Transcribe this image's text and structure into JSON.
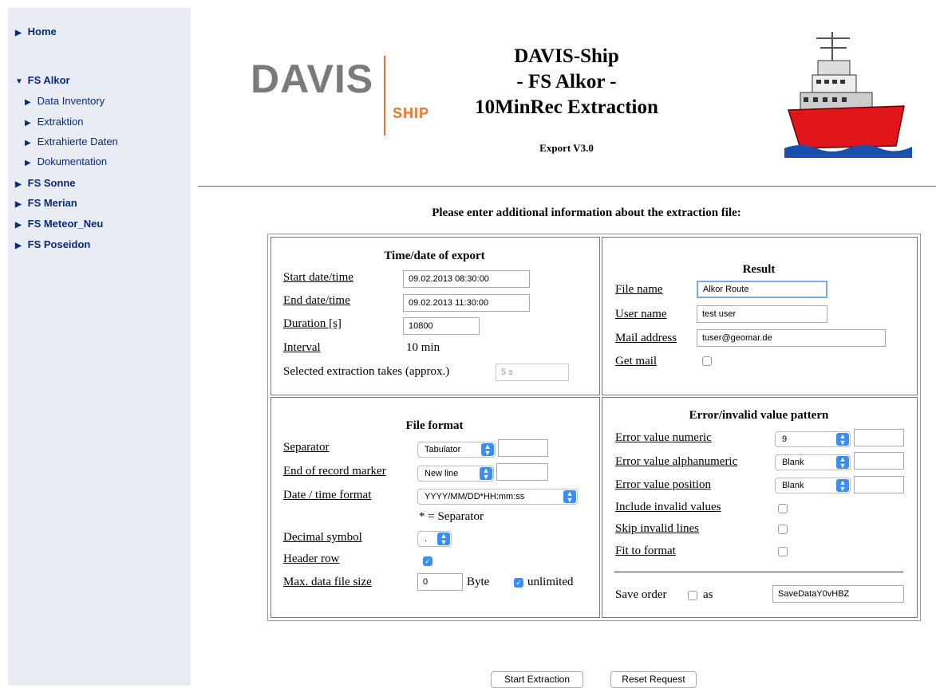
{
  "nav": {
    "home": "Home",
    "alkor": "FS Alkor",
    "alkor_items": [
      "Data Inventory",
      "Extraktion",
      "Extrahierte Daten",
      "Dokumentation"
    ],
    "sonne": "FS Sonne",
    "merian": "FS Merian",
    "meteor": "FS Meteor_Neu",
    "poseidon": "FS Poseidon"
  },
  "header": {
    "logo_main": "DAVIS",
    "logo_sub": "SHIP",
    "title_lines": [
      "DAVIS-Ship",
      "- FS Alkor -",
      "10MinRec Extraction"
    ],
    "version": "Export V3.0"
  },
  "prompt": "Please enter additional information about the extraction file:",
  "time": {
    "title": "Time/date of export",
    "start_label": "Start date/time",
    "start_value": "09.02.2013 08:30:00",
    "end_label": "End date/time",
    "end_value": "09.02.2013 11:30:00",
    "duration_label": "Duration [s]",
    "duration_value": "10800",
    "interval_label": "Interval",
    "interval_value": "10 min",
    "takes_label": "Selected extraction takes (approx.)",
    "takes_value": "5 s"
  },
  "result": {
    "title": "Result",
    "file_label": "File name",
    "file_value": "Alkor Route",
    "user_label": "User name",
    "user_value": "test user",
    "mail_label": "Mail address",
    "mail_value": "tuser@geomar.de",
    "getmail_label": "Get mail"
  },
  "format": {
    "title": "File format",
    "sep_label": "Separator",
    "sep_value": "Tabulator",
    "eor_label": "End of record marker",
    "eor_value": "New line",
    "dt_label": "Date / time format",
    "dt_value": "YYYY/MM/DD*HH:mm:ss",
    "dt_note": "* = Separator",
    "dec_label": "Decimal symbol",
    "dec_value": ".",
    "header_label": "Header row",
    "max_label": "Max. data file size",
    "max_value": "0",
    "byte": "Byte",
    "unlimited": "unlimited"
  },
  "error": {
    "title": "Error/invalid value pattern",
    "num_label": "Error value numeric",
    "num_value": "9",
    "alpha_label": "Error value alphanumeric",
    "alpha_value": "Blank",
    "pos_label": "Error value position",
    "pos_value": "Blank",
    "incl_label": "Include invalid values",
    "skip_label": "Skip invalid lines",
    "fit_label": "Fit to format",
    "save_label": "Save order",
    "as_label": "as",
    "save_value": "SaveDataY0vHBZ"
  },
  "buttons": {
    "start": "Start Extraction",
    "reset": "Reset Request"
  }
}
